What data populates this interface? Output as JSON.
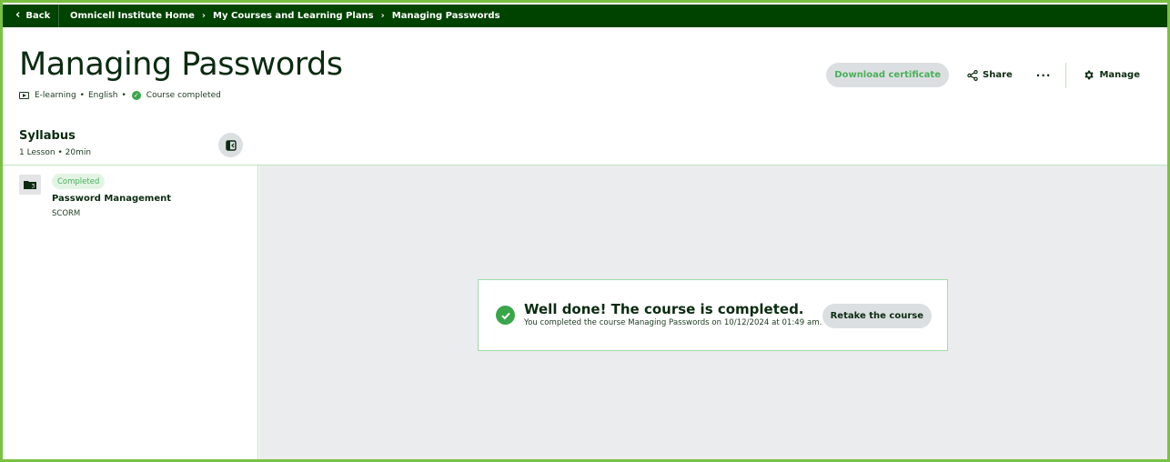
{
  "topbar": {
    "back_label": "Back",
    "breadcrumbs": [
      "Omnicell Institute Home",
      "My Courses and Learning Plans",
      "Managing Passwords"
    ]
  },
  "header": {
    "title": "Managing Passwords",
    "meta": {
      "format": "E-learning",
      "language": "English",
      "status": "Course completed"
    },
    "actions": {
      "download_certificate": "Download certificate",
      "share": "Share",
      "more": "···",
      "manage": "Manage"
    }
  },
  "syllabus": {
    "title": "Syllabus",
    "lessons_count": "1 Lesson",
    "duration": "20min",
    "items": [
      {
        "status": "Completed",
        "title": "Password Management",
        "type": "SCORM"
      }
    ]
  },
  "completion": {
    "title": "Well done! The course is completed.",
    "description": "You completed the course Managing Passwords on 10/12/2024 at 01:49 am.",
    "retake_label": "Retake the course"
  },
  "colors": {
    "topbar": "#004200",
    "frame": "#7ac143",
    "accent_green": "#3aa64a",
    "content_bg": "#ebecee"
  }
}
